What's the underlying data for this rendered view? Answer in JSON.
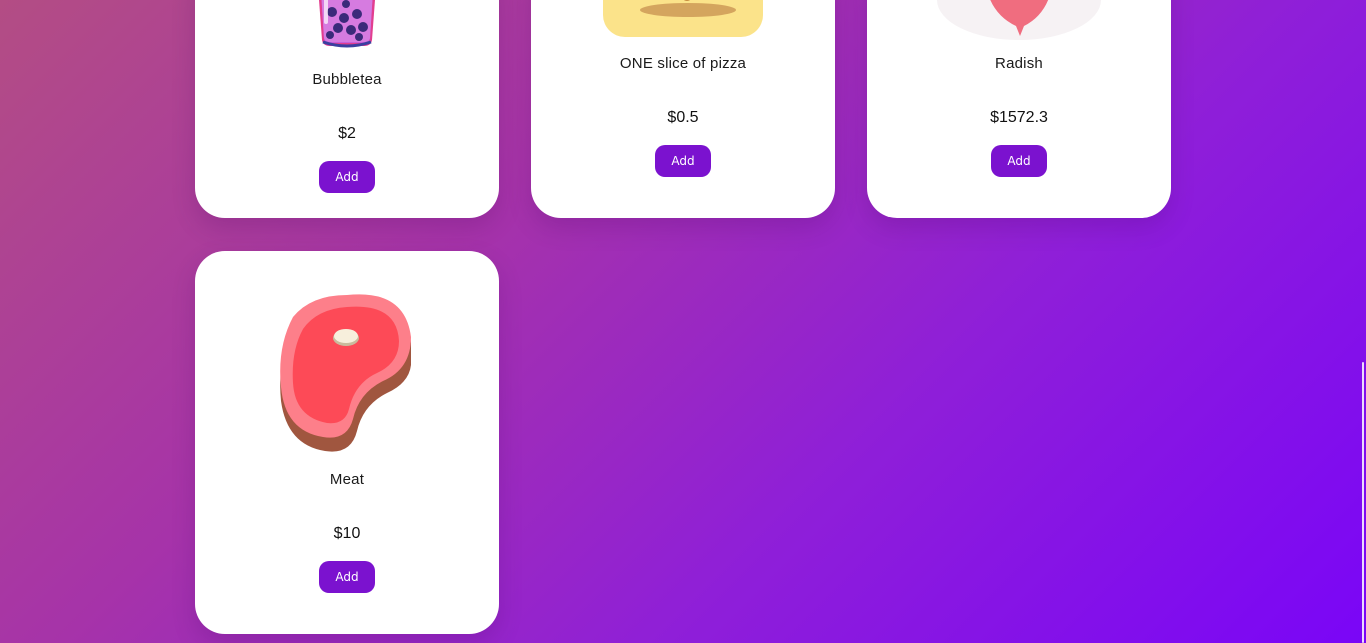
{
  "products": [
    {
      "name": "Bubbletea",
      "price": "$2",
      "add_label": "Add",
      "image": "bubbletea-icon"
    },
    {
      "name": "ONE slice of pizza",
      "price": "$0.5",
      "add_label": "Add",
      "image": "pizza-icon"
    },
    {
      "name": "Radish",
      "price": "$1572.3",
      "add_label": "Add",
      "image": "radish-icon"
    },
    {
      "name": "Meat",
      "price": "$10",
      "add_label": "Add",
      "image": "meat-icon"
    }
  ],
  "colors": {
    "accent": "#7b12cf",
    "background_start": "#b34d84",
    "background_end": "#7a05f7",
    "card": "#ffffff"
  }
}
